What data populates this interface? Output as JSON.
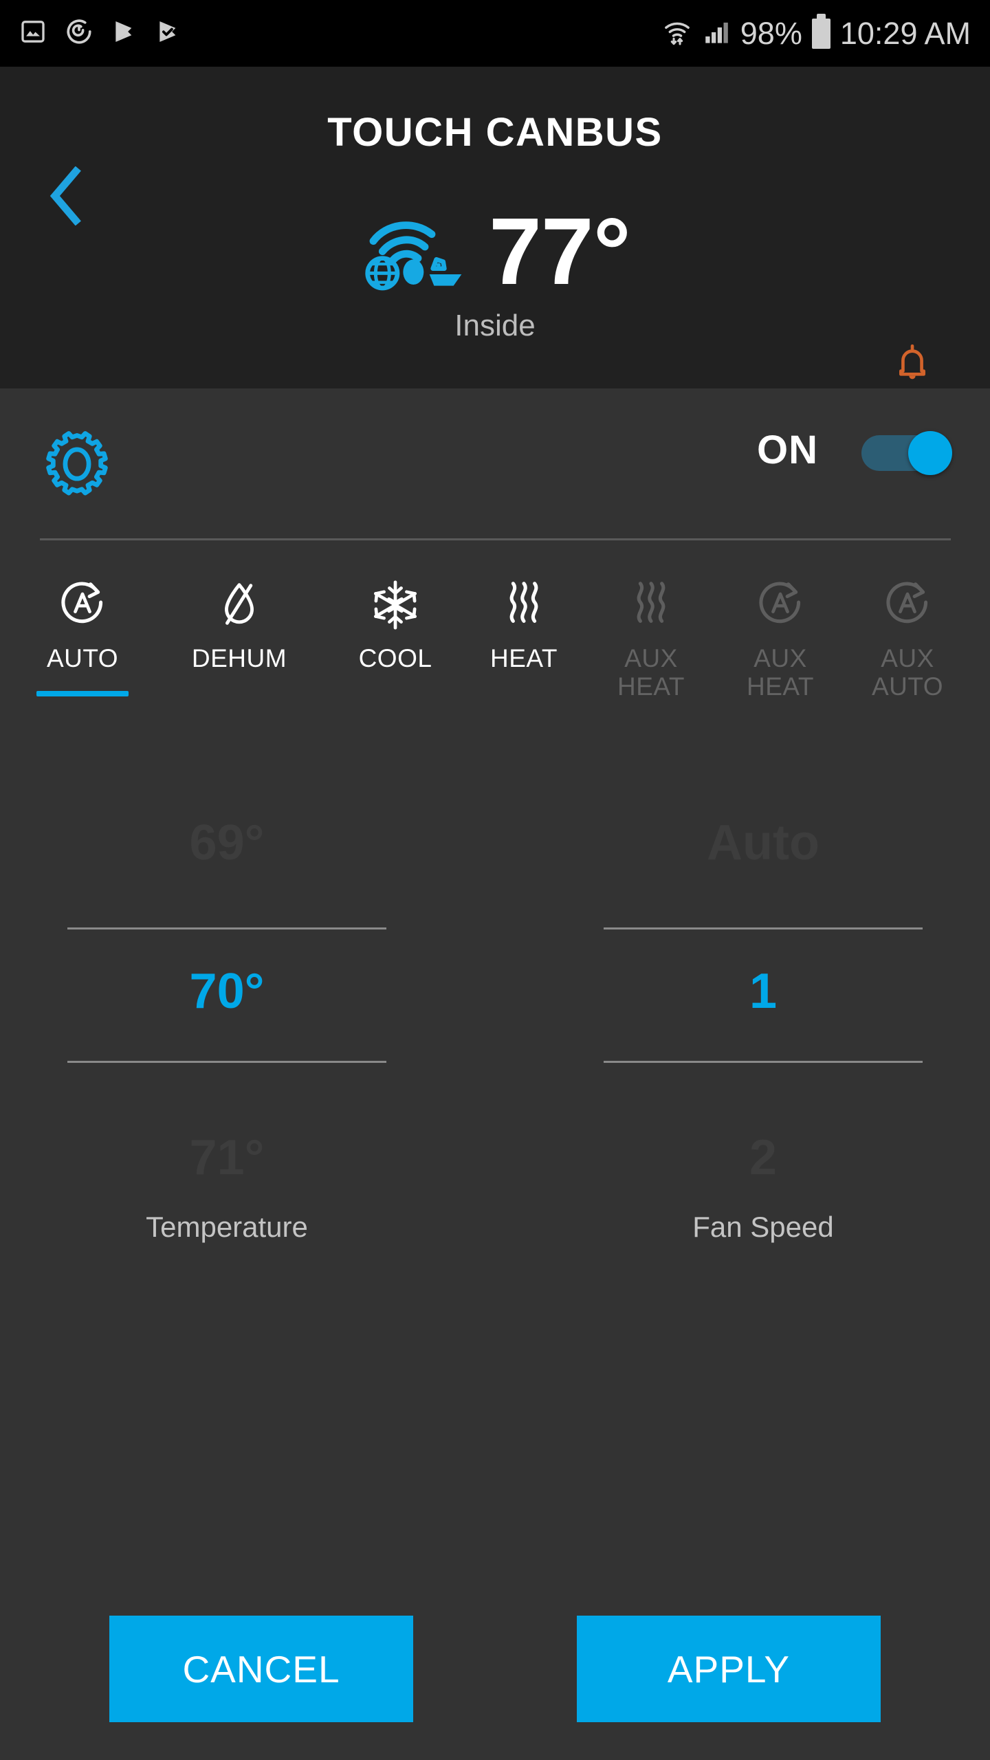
{
  "status_bar": {
    "left_icons": [
      "image-icon",
      "sync-icon",
      "play-store-icon",
      "play-store-update-icon"
    ],
    "right_icons": [
      "wifi-transfer-icon",
      "cellular-signal-icon",
      "battery-icon"
    ],
    "battery_percent": "98%",
    "time": "10:29 AM"
  },
  "header": {
    "back_icon": "chevron-left-icon",
    "title": "TOUCH CANBUS",
    "connectivity_icon": "globe-wifi-boat-icon",
    "temperature": "77°",
    "temperature_label": "Inside",
    "alert_icon": "bell-icon"
  },
  "settings": {
    "gear_icon": "gear-icon",
    "power_label": "ON",
    "power_state": "on"
  },
  "modes": {
    "tabs": [
      {
        "label": "AUTO",
        "icon": "auto-circle-icon",
        "state": "active"
      },
      {
        "label": "DEHUM",
        "icon": "droplet-slash-icon",
        "state": "enabled"
      },
      {
        "label": "COOL",
        "icon": "snowflake-icon",
        "state": "enabled"
      },
      {
        "label": "HEAT",
        "icon": "heat-waves-icon",
        "state": "enabled"
      },
      {
        "label": "AUX\nHEAT",
        "icon": "heat-waves-icon",
        "state": "disabled"
      },
      {
        "label": "AUX\nHEAT",
        "icon": "auto-circle-icon",
        "state": "disabled"
      },
      {
        "label": "AUX\nAUTO",
        "icon": "auto-circle-icon",
        "state": "disabled"
      }
    ]
  },
  "temperature_picker": {
    "label": "Temperature",
    "previous": "69°",
    "selected": "70°",
    "next": "71°"
  },
  "fan_speed_picker": {
    "label": "Fan Speed",
    "previous": "Auto",
    "selected": "1",
    "next": "2"
  },
  "actions": {
    "cancel_label": "CANCEL",
    "apply_label": "APPLY"
  },
  "colors": {
    "accent": "#00a8e8",
    "alert": "#d2632b",
    "card_bg": "#333333",
    "header_bg": "#212121",
    "status_bg": "#000000",
    "dim_text": "#3d3d3d"
  }
}
